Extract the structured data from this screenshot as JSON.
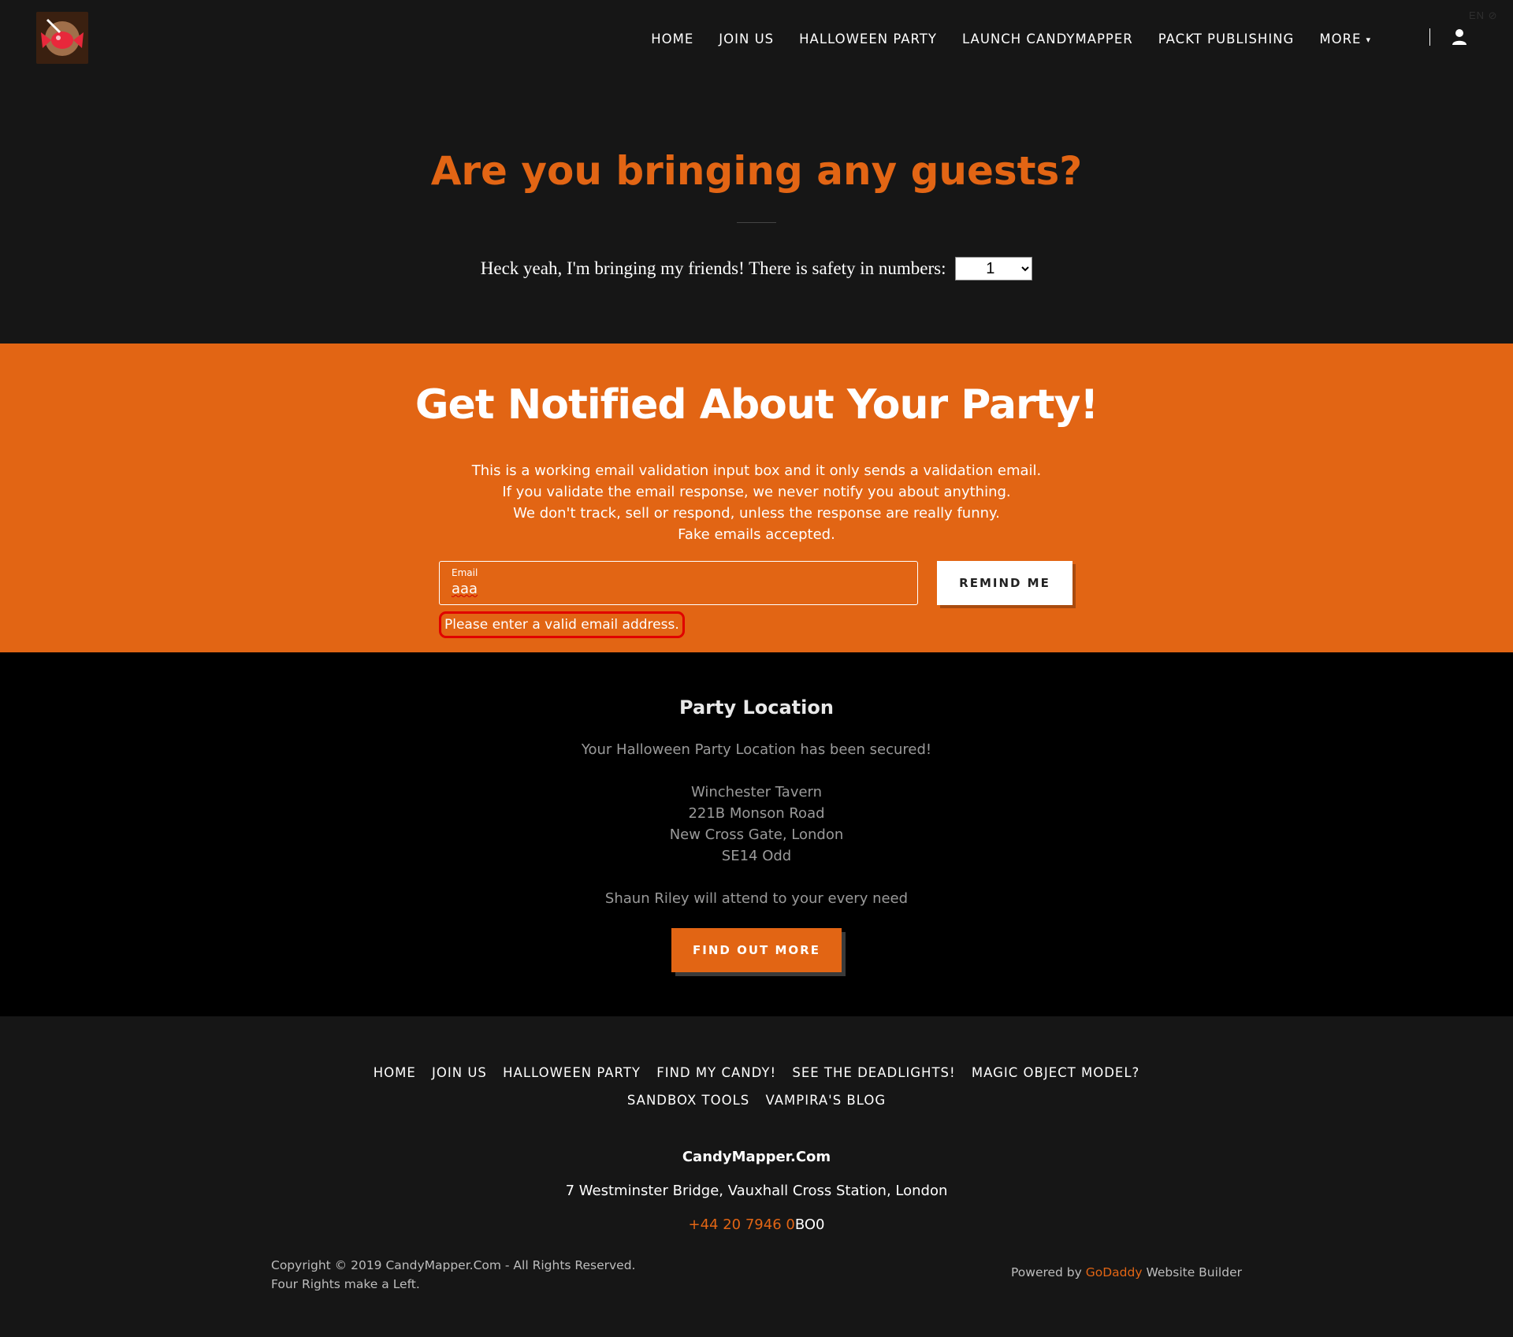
{
  "header": {
    "logo_icon": "candy-logo-icon",
    "nav": [
      {
        "label": "HOME"
      },
      {
        "label": "JOIN US"
      },
      {
        "label": "HALLOWEEN PARTY"
      },
      {
        "label": "LAUNCH CANDYMAPPER"
      },
      {
        "label": "PACKT PUBLISHING"
      },
      {
        "label": "MORE"
      }
    ],
    "more_caret": "▾",
    "user_icon": "user-icon",
    "lang": "EN ⊘"
  },
  "guests": {
    "title": "Are you bringing any guests?",
    "prompt": "Heck yeah, I'm bringing my friends! There is safety in numbers:",
    "selected_count": "1"
  },
  "notify": {
    "title": "Get Notified About Your Party!",
    "lines": [
      "This is a working email validation input box and it only sends a validation email.",
      "If you validate the email response, we never notify you about anything.",
      "We don't track, sell or respond, unless the response are really funny.",
      "Fake emails accepted."
    ],
    "email_label": "Email",
    "email_value": "aaa",
    "button": "REMIND ME",
    "error": "Please enter a valid email address."
  },
  "location": {
    "title": "Party Location",
    "secured": "Your Halloween Party Location has been secured!",
    "address_lines": [
      "Winchester Tavern",
      "221B Monson Road",
      "New Cross Gate, London",
      "SE14 Odd"
    ],
    "host": "Shaun Riley will attend to your every need",
    "button": "FIND OUT MORE"
  },
  "footer": {
    "nav_row1": [
      "HOME",
      "JOIN US",
      "HALLOWEEN PARTY",
      "FIND MY CANDY!",
      "SEE THE DEADLIGHTS!",
      "MAGIC OBJECT MODEL?"
    ],
    "nav_row2": [
      "SANDBOX TOOLS",
      "VAMPIRA'S BLOG"
    ],
    "brand": "CandyMapper.Com",
    "address": "7 Westminster Bridge, Vauxhall Cross Station, London",
    "phone_orange": "+44 20 7946 0",
    "phone_white": "BO0",
    "copyright_1": "Copyright © 2019 CandyMapper.Com - All Rights Reserved.",
    "copyright_2": "Four Rights make a Left.",
    "powered_prefix": "Powered by ",
    "powered_brand": "GoDaddy",
    "powered_suffix": " Website Builder"
  },
  "colors": {
    "accent": "#e26514",
    "background": "#161616",
    "error_border": "#e00000"
  }
}
